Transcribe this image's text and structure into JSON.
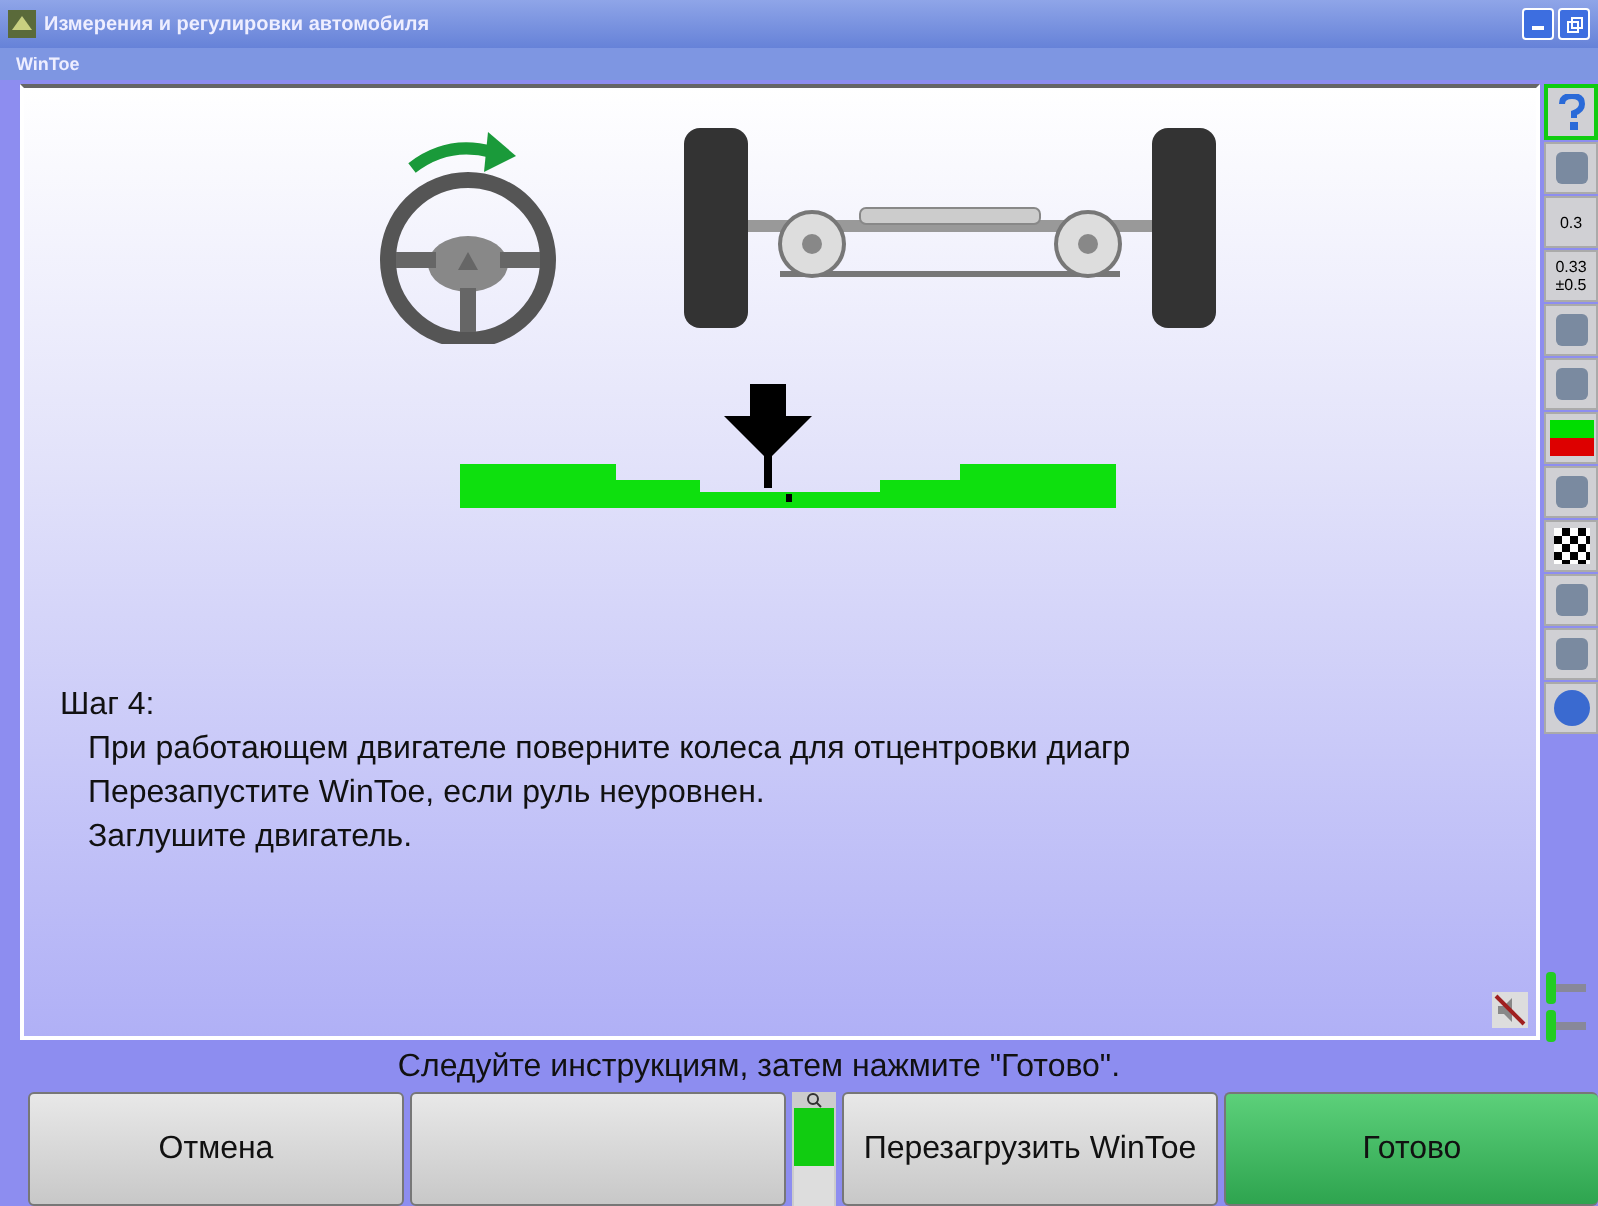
{
  "window": {
    "title": "Измерения и регулировки автомобиля"
  },
  "subtitle": "WinToe",
  "toolbar": [
    {
      "kind": "help",
      "selected": true
    },
    {
      "kind": "monitor",
      "selected": false
    },
    {
      "kind": "value",
      "text": "0.3",
      "selected": false
    },
    {
      "kind": "reading",
      "text": "0.33",
      "text2": "±0.5",
      "selected": false
    },
    {
      "kind": "tools",
      "selected": false
    },
    {
      "kind": "wheel",
      "selected": false
    },
    {
      "kind": "display",
      "selected": false
    },
    {
      "kind": "sensor",
      "selected": false
    },
    {
      "kind": "flag",
      "selected": false
    },
    {
      "kind": "printer",
      "selected": false
    },
    {
      "kind": "report",
      "selected": false
    },
    {
      "kind": "globe",
      "selected": false
    }
  ],
  "step": {
    "title": "Шаг 4:",
    "lines": [
      "При работающем двигателе поверните колеса для отцентровки диагр",
      "Перезапустите WinToe, если руль неуровнен.",
      "Заглушите двигатель."
    ]
  },
  "instruction": "Следуйте инструкциям, затем нажмите \"Готово\".",
  "meter": {
    "level": 0.6
  },
  "buttons": [
    {
      "kind": "normal",
      "label": "Отмена"
    },
    {
      "kind": "blank"
    },
    {
      "kind": "meter"
    },
    {
      "kind": "normal",
      "label": "Перезагрузить WinToe"
    },
    {
      "kind": "primary",
      "label": "Готово"
    }
  ]
}
